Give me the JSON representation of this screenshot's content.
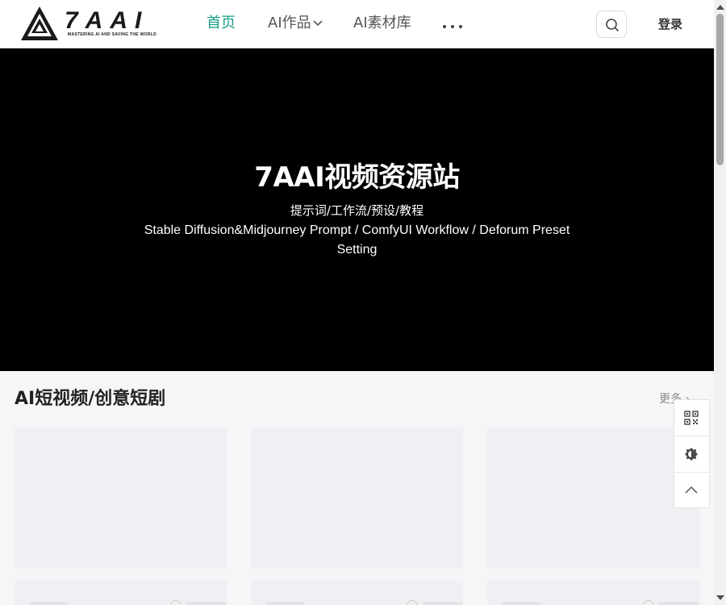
{
  "logo": {
    "text": "7AAI",
    "tagline": "MASTERING AI AND SAVING THE WORLD"
  },
  "nav": {
    "items": [
      {
        "label": "首页",
        "active": true
      },
      {
        "label": "AI作品",
        "has_dropdown": true
      },
      {
        "label": "AI素材库"
      }
    ],
    "more_icon": "more-dots-icon",
    "search_icon": "search-icon",
    "login_label": "登录"
  },
  "hero": {
    "title": "7AAI视频资源站",
    "subtitle": "提示词/工作流/预设/教程",
    "description": "Stable Diffusion&Midjourney Prompt / ComfyUI Workflow / Deforum Preset Setting"
  },
  "section": {
    "title": "AI短视频/创意短剧",
    "more_label": "更多 ›"
  },
  "float_toolbar": {
    "icons": [
      "qr-code-icon",
      "theme-toggle-icon",
      "back-to-top-icon"
    ]
  },
  "colors": {
    "accent": "#16a085",
    "hero_bg": "#000000",
    "page_bg": "#f5f6f7",
    "placeholder": "#eef0f3"
  }
}
